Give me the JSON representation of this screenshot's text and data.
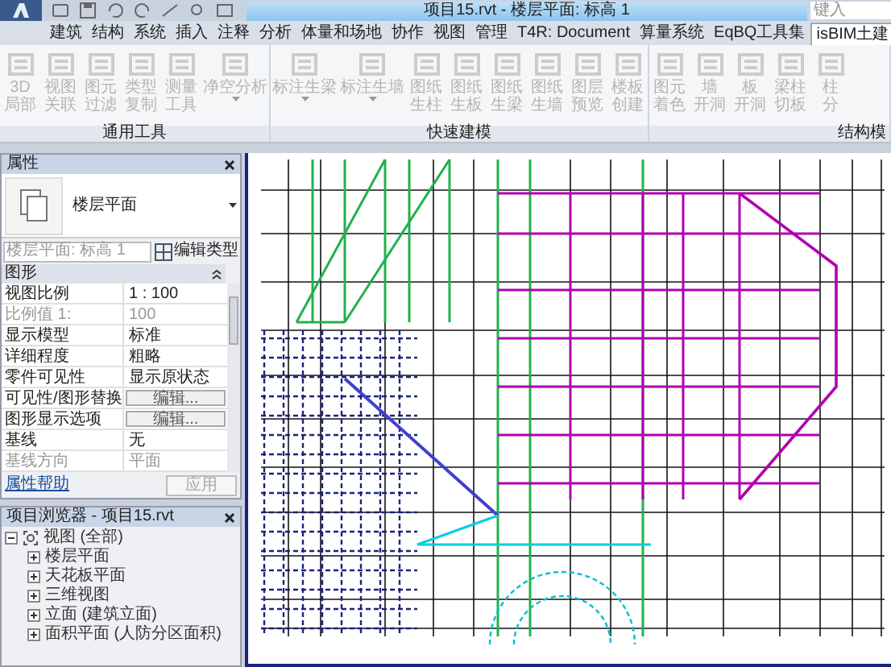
{
  "window": {
    "title": "项目15.rvt - 楼层平面: 标高 1"
  },
  "search": {
    "placeholder": "键入"
  },
  "ribbon_tabs": [
    {
      "label": "建筑",
      "selected": false
    },
    {
      "label": "结构",
      "selected": false
    },
    {
      "label": "系统",
      "selected": false
    },
    {
      "label": "插入",
      "selected": false
    },
    {
      "label": "注释",
      "selected": false
    },
    {
      "label": "分析",
      "selected": false
    },
    {
      "label": "体量和场地",
      "selected": false
    },
    {
      "label": "协作",
      "selected": false
    },
    {
      "label": "视图",
      "selected": false
    },
    {
      "label": "管理",
      "selected": false
    },
    {
      "label": "T4R: Document",
      "selected": false
    },
    {
      "label": "算量系统",
      "selected": false
    },
    {
      "label": "EqBQ工具集",
      "selected": false
    },
    {
      "label": "isBIM土建",
      "selected": true
    }
  ],
  "ribbon_panels": [
    {
      "label": "通用工具",
      "buttons": [
        {
          "lines": [
            "3D",
            "局部"
          ],
          "dropdown": false,
          "disabled": true
        },
        {
          "lines": [
            "视图",
            "关联"
          ],
          "dropdown": false,
          "disabled": true
        },
        {
          "lines": [
            "图元",
            "过滤"
          ],
          "dropdown": false,
          "disabled": true
        },
        {
          "lines": [
            "类型",
            "复制"
          ],
          "dropdown": false,
          "disabled": true
        },
        {
          "lines": [
            "测量",
            "工具"
          ],
          "dropdown": false,
          "disabled": true
        },
        {
          "lines": [
            "净空分析"
          ],
          "dropdown": true,
          "disabled": true
        }
      ]
    },
    {
      "label": "快速建模",
      "buttons": [
        {
          "lines": [
            "标注生梁"
          ],
          "dropdown": true,
          "disabled": true
        },
        {
          "lines": [
            "标注生墙"
          ],
          "dropdown": true,
          "disabled": true
        },
        {
          "lines": [
            "图纸",
            "生柱"
          ],
          "dropdown": false,
          "disabled": true
        },
        {
          "lines": [
            "图纸",
            "生板"
          ],
          "dropdown": false,
          "disabled": true
        },
        {
          "lines": [
            "图纸",
            "生梁"
          ],
          "dropdown": false,
          "disabled": true
        },
        {
          "lines": [
            "图纸",
            "生墙"
          ],
          "dropdown": false,
          "disabled": true
        },
        {
          "lines": [
            "图层",
            "预览"
          ],
          "dropdown": false,
          "disabled": true
        },
        {
          "lines": [
            "楼板",
            "创建"
          ],
          "dropdown": false,
          "disabled": true
        }
      ]
    },
    {
      "label": "结构模",
      "buttons": [
        {
          "lines": [
            "图元",
            "着色"
          ],
          "dropdown": false,
          "disabled": true
        },
        {
          "lines": [
            "墙",
            "开洞"
          ],
          "dropdown": false,
          "disabled": true
        },
        {
          "lines": [
            "板",
            "开洞"
          ],
          "dropdown": false,
          "disabled": true
        },
        {
          "lines": [
            "梁柱",
            "切板"
          ],
          "dropdown": false,
          "disabled": true
        },
        {
          "lines": [
            "柱",
            "分"
          ],
          "dropdown": false,
          "disabled": true
        }
      ]
    }
  ],
  "properties": {
    "title": "属性",
    "type_name": "楼层平面",
    "instance_selector": "楼层平面: 标高 1",
    "edit_type_button": "编辑类型",
    "group": "图形",
    "rows": [
      {
        "name": "视图比例",
        "value": "1 : 100",
        "kind": "text",
        "disabled": false
      },
      {
        "name": "比例值 1:",
        "value": "100",
        "kind": "text",
        "disabled": true
      },
      {
        "name": "显示模型",
        "value": "标准",
        "kind": "text",
        "disabled": false
      },
      {
        "name": "详细程度",
        "value": "粗略",
        "kind": "text",
        "disabled": false
      },
      {
        "name": "零件可见性",
        "value": "显示原状态",
        "kind": "text",
        "disabled": false
      },
      {
        "name": "可见性/图形替换",
        "value": "编辑...",
        "kind": "button",
        "disabled": false
      },
      {
        "name": "图形显示选项",
        "value": "编辑...",
        "kind": "button",
        "disabled": false
      },
      {
        "name": "基线",
        "value": "无",
        "kind": "text",
        "disabled": false
      },
      {
        "name": "基线方向",
        "value": "平面",
        "kind": "text",
        "disabled": true
      }
    ],
    "help_link": "属性帮助",
    "apply_button": {
      "label": "应用",
      "disabled": true
    }
  },
  "project_browser": {
    "title": "项目浏览器 - 项目15.rvt",
    "tree": [
      {
        "label": "视图 (全部)",
        "expanded": true,
        "children": [
          {
            "label": "楼层平面",
            "expanded": false
          },
          {
            "label": "天花板平面",
            "expanded": false
          },
          {
            "label": "三维视图",
            "expanded": false
          },
          {
            "label": "立面 (建筑立面)",
            "expanded": false
          },
          {
            "label": "面积平面 (人防分区面积)",
            "expanded": false
          }
        ]
      }
    ]
  }
}
